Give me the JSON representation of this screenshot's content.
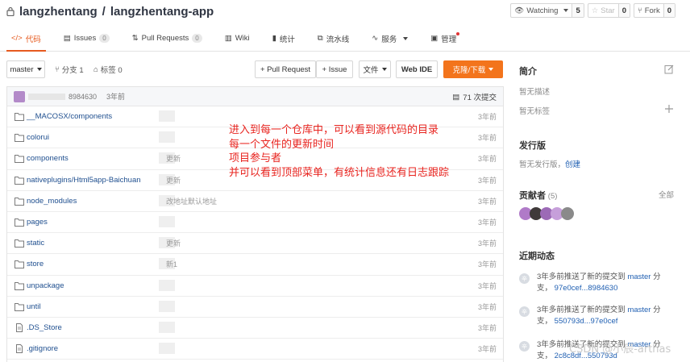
{
  "repo": {
    "owner": "langzhentang",
    "separator": "/",
    "name": "langzhentang-app"
  },
  "actions": [
    {
      "label": "Watching",
      "count": "5"
    },
    {
      "label": "Star",
      "count": "0"
    },
    {
      "label": "Fork",
      "count": "0"
    }
  ],
  "tabs": [
    {
      "label": "代码"
    },
    {
      "label": "Issues",
      "badge": "0"
    },
    {
      "label": "Pull Requests",
      "badge": "0"
    },
    {
      "label": "Wiki"
    },
    {
      "label": "统计"
    },
    {
      "label": "流水线"
    },
    {
      "label": "服务"
    },
    {
      "label": "管理"
    }
  ],
  "toolbar": {
    "branch": "master",
    "branches": "分支 1",
    "tags": "标签 0",
    "pull_request": "+ Pull Request",
    "issue": "+ Issue",
    "file": "文件",
    "web_ide": "Web IDE",
    "clone": "克隆/下载"
  },
  "commit": {
    "hash": "8984630",
    "ago": "3年前",
    "total": "71 次提交"
  },
  "files": [
    {
      "name": "__MACOSX/components",
      "msg": "",
      "time": "3年前",
      "type": "folder"
    },
    {
      "name": "colorui",
      "msg": "",
      "time": "3年前",
      "type": "folder"
    },
    {
      "name": "components",
      "msg": "更新",
      "time": "3年前",
      "type": "folder"
    },
    {
      "name": "nativeplugins/Html5app-Baichuan",
      "msg": "更新",
      "time": "3年前",
      "type": "folder"
    },
    {
      "name": "node_modules",
      "msg": "改地址默认地址",
      "time": "3年前",
      "type": "folder"
    },
    {
      "name": "pages",
      "msg": "",
      "time": "3年前",
      "type": "folder"
    },
    {
      "name": "static",
      "msg": "更新",
      "time": "3年前",
      "type": "folder"
    },
    {
      "name": "store",
      "msg": "新1",
      "time": "3年前",
      "type": "folder"
    },
    {
      "name": "unpackage",
      "msg": "",
      "time": "3年前",
      "type": "folder"
    },
    {
      "name": "until",
      "msg": "",
      "time": "3年前",
      "type": "folder"
    },
    {
      "name": ".DS_Store",
      "msg": "",
      "time": "3年前",
      "type": "file"
    },
    {
      "name": ".gitignore",
      "msg": "",
      "time": "3年前",
      "type": "file"
    }
  ],
  "annotation": [
    "进入到每一个仓库中，可以看到源代码的目录",
    "每一个文件的更新时间",
    "项目参与者",
    "并可以看到顶部菜单，有统计信息还有日志跟踪"
  ],
  "sidebar": {
    "intro_title": "简介",
    "no_desc": "暂无描述",
    "no_tags": "暂无标签",
    "release_title": "发行版",
    "no_release": "暂无发行版，",
    "create": "创建",
    "contributors_title": "贡献者",
    "contributors_count": "(5)",
    "all": "全部",
    "activity_title": "近期动态",
    "activities": [
      {
        "icon": "辛",
        "text": "3年多前推送了新的提交到",
        "branch": "master",
        "tail": "分支，",
        "range": "97e0cef...8984630"
      },
      {
        "icon": "辛",
        "text": "3年多前推送了新的提交到",
        "branch": "master",
        "tail": "分支，",
        "range": "550793d...97e0cef"
      },
      {
        "icon": "辛",
        "text": "3年多前推送了新的提交到",
        "branch": "master",
        "tail": "分支，",
        "range": "2c8c8df...550793d"
      }
    ]
  },
  "watermark": "CSDN @小辰-arthas",
  "colors": {
    "accent": "#e65a1f",
    "clone_button": "#f3741c",
    "link": "#1f5fb2",
    "annotation": "#e8241f"
  }
}
